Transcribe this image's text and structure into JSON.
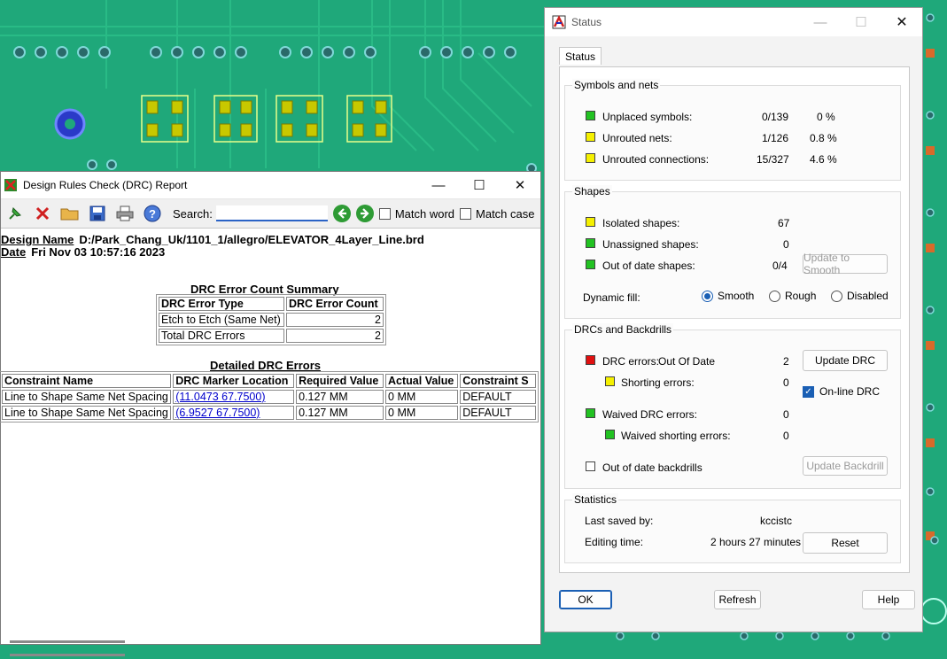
{
  "drc": {
    "window_title": "Design Rules Check (DRC) Report",
    "search_label": "Search:",
    "search_value": "",
    "match_word_label": "Match word",
    "match_case_label": "Match case",
    "design_name_label": "Design Name",
    "design_name_value": "D:/Park_Chang_Uk/1101_1/allegro/ELEVATOR_4Layer_Line.brd",
    "date_label": "Date",
    "date_value": "Fri Nov 03 10:57:16 2023",
    "summary": {
      "title": "DRC Error Count Summary",
      "headers": [
        "DRC Error Type",
        "DRC Error Count"
      ],
      "rows": [
        [
          "Etch to Etch (Same Net)",
          "2"
        ],
        [
          "Total DRC Errors",
          "2"
        ]
      ]
    },
    "detailed": {
      "title": "Detailed DRC Errors",
      "headers": [
        "Constraint Name",
        "DRC Marker Location",
        "Required Value",
        "Actual Value",
        "Constraint S"
      ],
      "rows": [
        [
          "Line to Shape Same Net Spacing",
          "(11.0473 67.7500)",
          "0.127 MM",
          "0 MM",
          "DEFAULT"
        ],
        [
          "Line to Shape Same Net Spacing",
          "(6.9527 67.7500)",
          "0.127 MM",
          "0 MM",
          "DEFAULT"
        ]
      ]
    }
  },
  "status": {
    "window_title": "Status",
    "tab_label": "Status",
    "symbols_group": "Symbols and nets",
    "unplaced_label": "Unplaced symbols:",
    "unplaced_count": "0/139",
    "unplaced_pct": "0 %",
    "unrouted_nets_label": "Unrouted nets:",
    "unrouted_nets_count": "1/126",
    "unrouted_nets_pct": "0.8 %",
    "unrouted_conn_label": "Unrouted connections:",
    "unrouted_conn_count": "15/327",
    "unrouted_conn_pct": "4.6 %",
    "shapes_group": "Shapes",
    "isolated_label": "Isolated shapes:",
    "isolated_value": "67",
    "unassigned_label": "Unassigned shapes:",
    "unassigned_value": "0",
    "outdated_shapes_label": "Out of date shapes:",
    "outdated_shapes_value": "0/4",
    "update_smooth_label": "Update to Smooth",
    "dynamic_fill_label": "Dynamic fill:",
    "smooth_label": "Smooth",
    "rough_label": "Rough",
    "disabled_label": "Disabled",
    "drc_group": "DRCs and Backdrills",
    "drc_errors_label": "DRC errors:",
    "drc_errors_state": "Out Of Date",
    "drc_errors_value": "2",
    "update_drc_label": "Update DRC",
    "shorting_label": "Shorting errors:",
    "shorting_value": "0",
    "online_drc_label": "On-line DRC",
    "waived_label": "Waived DRC errors:",
    "waived_value": "0",
    "waived_short_label": "Waived shorting errors:",
    "waived_short_value": "0",
    "backdrills_label": "Out of date backdrills",
    "update_backdrill_label": "Update Backdrill",
    "stats_group": "Statistics",
    "last_saved_label": "Last saved by:",
    "last_saved_value": "kccistc",
    "editing_label": "Editing time:",
    "editing_value": "2 hours 27 minutes",
    "reset_label": "Reset",
    "ok_label": "OK",
    "refresh_label": "Refresh",
    "help_label": "Help"
  },
  "colors": {
    "pcb_green": "#1fa87a",
    "indicator_green": "#22c222",
    "indicator_yellow": "#f5f000",
    "indicator_red": "#e01010",
    "link_blue": "#0000cc"
  }
}
